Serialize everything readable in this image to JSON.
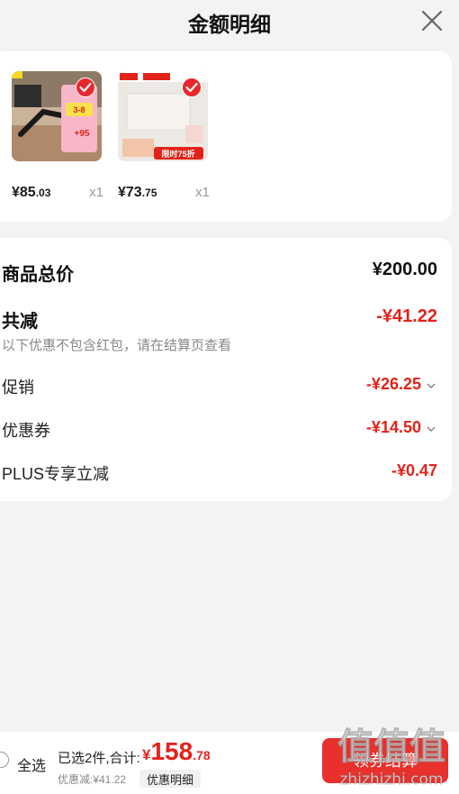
{
  "header": {
    "title": "金额明细",
    "close_icon": "close-icon"
  },
  "products": [
    {
      "price_int": "¥85",
      "price_dec": ".03",
      "qty": "x1",
      "image": "monitor-arm-product-image"
    },
    {
      "price_int": "¥73",
      "price_dec": ".75",
      "qty": "x1",
      "image": "ceiling-light-product-image"
    }
  ],
  "summary": {
    "goods_total_label": "商品总价",
    "goods_total_value": "¥200.00",
    "total_reduce_label": "共减",
    "total_reduce_value": "-¥41.22",
    "note": "以下优惠不包含红包，请在结算页查看",
    "promo_label": "促销",
    "promo_value": "-¥26.25",
    "coupon_label": "优惠券",
    "coupon_value": "-¥14.50",
    "plus_label": "PLUS专享立减",
    "plus_value": "-¥0.47"
  },
  "bottom_bar": {
    "select_all": "全选",
    "selected_text": "已选2件,合计:",
    "total_currency": "¥",
    "total_int": "158",
    "total_dec": ".78",
    "discount_text": "优惠减:¥41.22",
    "detail_button": "优惠明细",
    "checkout_button": "领券结算"
  },
  "watermark": {
    "line1": "值|值|值",
    "line2": "zhizhizhi.com"
  },
  "colors": {
    "accent_red": "#e2231a",
    "checkout_red": "#e8302c",
    "background": "#f3f3f3"
  }
}
